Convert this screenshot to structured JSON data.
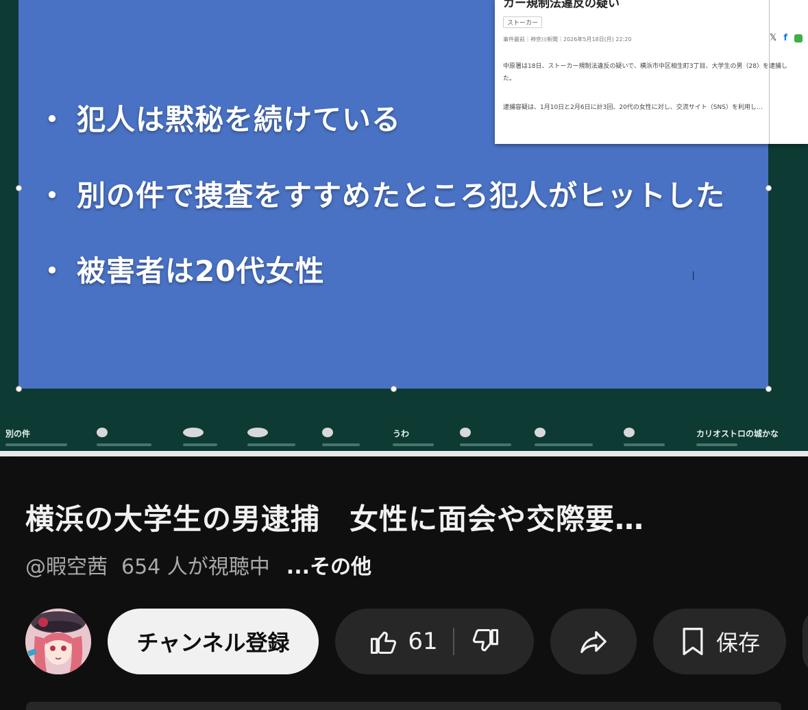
{
  "slide": {
    "bullets": [
      "犯人は黙秘を続けている",
      "別の件で捜査をすすめたところ犯人がヒットした",
      "被害者は20代女性"
    ],
    "bullet_marker": "・",
    "background": "#4a72c4"
  },
  "news": {
    "title": "カー規制法違反の疑い",
    "tag": "ストーカー",
    "meta": "事件最前｜神奈川新聞｜2026年5月18日(月) 22:20",
    "share_icons": [
      "x-icon",
      "facebook-icon",
      "line-icon"
    ],
    "paragraph1": "中原署は18日、ストーカー規制法違反の疑いで、横浜市中区相生町3丁目、大学生の男（28）を逮捕した。",
    "paragraph2": "逮捕容疑は、1月10日と2月6日に計3回、20代の女性に対し、交流サイト（SNS）を利用し…"
  },
  "ticker": {
    "items": [
      "別の件",
      "うわ",
      "カリオストロの城かな"
    ]
  },
  "video": {
    "title": "横浜の大学生の男逮捕　女性に面会や交際要…",
    "channel": "@暇空茜",
    "viewers": "654 人が視聴中",
    "more": "...その他"
  },
  "actions": {
    "subscribe": "チャンネル登録",
    "like_count": "61",
    "save": "保存"
  },
  "colors": {
    "panel_bg": "#0f0f0f",
    "pill_bg": "#272727",
    "subscribe_bg": "#f1f1f1",
    "video_bg": "#0d3a33"
  }
}
